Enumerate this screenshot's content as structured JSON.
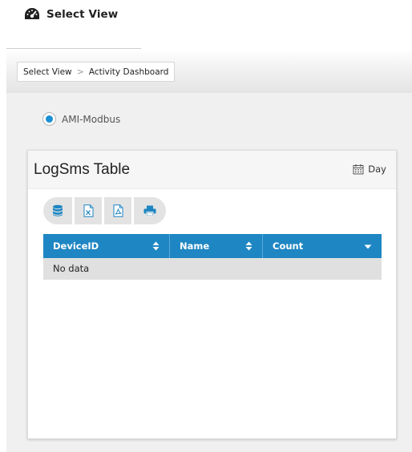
{
  "header": {
    "title": "Select View",
    "icon": "dashboard-gauge-icon"
  },
  "breadcrumb": {
    "items": [
      "Select View",
      "Activity Dashboard"
    ],
    "separator": ">"
  },
  "selection": {
    "radio_label": "AMI-Modbus",
    "checked": true
  },
  "card": {
    "title": "LogSms Table",
    "range_label": "Day",
    "range_icon": "calendar-icon"
  },
  "toolbar": {
    "buttons": [
      {
        "icon": "database-icon"
      },
      {
        "icon": "excel-export-icon"
      },
      {
        "icon": "pdf-export-icon"
      },
      {
        "icon": "print-icon"
      }
    ]
  },
  "table": {
    "columns": [
      "DeviceID",
      "Name",
      "Count"
    ],
    "empty_text": "No data"
  },
  "colors": {
    "accent": "#1e86c3",
    "radio": "#1a8fd3",
    "toolbar_bg": "#e3e3e3",
    "empty_row_bg": "#e0e0e0"
  }
}
